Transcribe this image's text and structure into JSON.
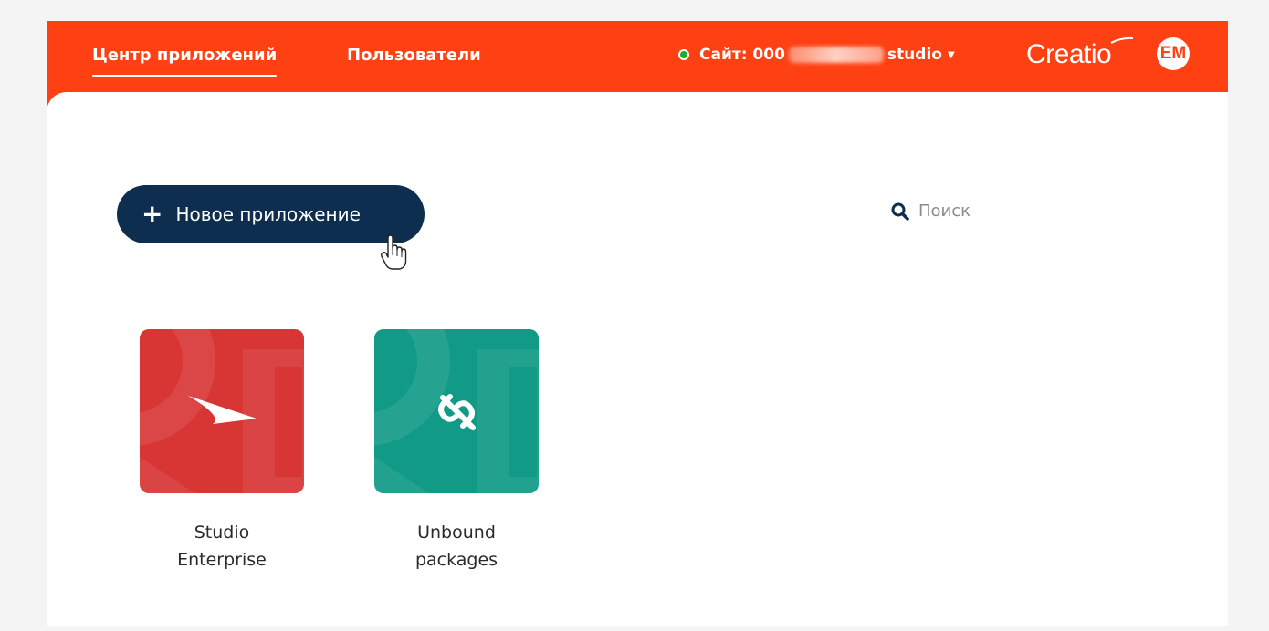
{
  "header": {
    "tabs": [
      {
        "label": "Центр приложений",
        "active": true
      },
      {
        "label": "Пользователи",
        "active": false
      }
    ],
    "site": {
      "prefix": "Сайт: 000",
      "suffix": "studio",
      "status_color": "#1eab2f"
    },
    "brand": "Creatio",
    "avatar_initials": "EM",
    "accent_color": "#ff4013"
  },
  "main": {
    "new_app_button": {
      "label": "Новое приложение",
      "icon": "plus-icon",
      "color": "#0d2e4f"
    },
    "search": {
      "placeholder": "Поиск",
      "icon": "search-icon"
    },
    "apps": [
      {
        "line1": "Studio",
        "line2": "Enterprise",
        "color": "#d83535",
        "icon": "arrow-icon"
      },
      {
        "line1": "Unbound",
        "line2": "packages",
        "color": "#119a86",
        "icon": "broken-link-icon"
      }
    ]
  }
}
